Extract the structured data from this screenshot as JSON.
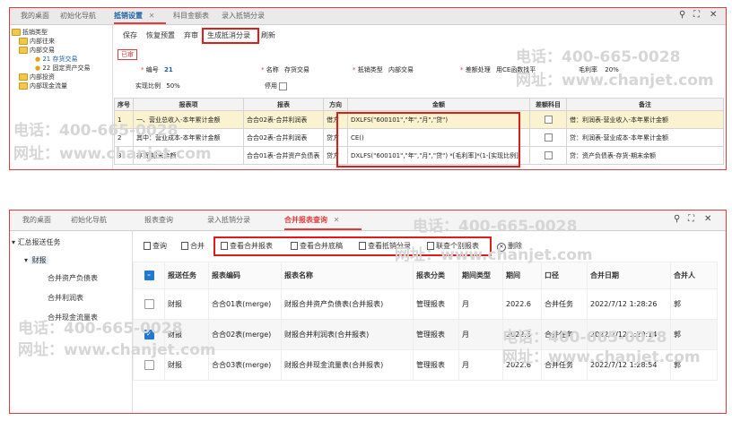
{
  "top": {
    "tabs": [
      {
        "label": "我的桌面"
      },
      {
        "label": "初始化导航"
      },
      {
        "label": "抵销设置"
      },
      {
        "label": "科目金额表"
      },
      {
        "label": "录入抵销分录"
      }
    ],
    "tree": {
      "root": "抵销类型",
      "items": [
        "内部往来",
        "内部交易",
        "21 存货交易",
        "22 固定资产交易",
        "内部投资",
        "内部现金流量"
      ]
    },
    "toolbar": {
      "save": "保存",
      "restore": "恢复预置",
      "reject": "弃审",
      "generate": "生成抵消分录",
      "refresh": "刷新"
    },
    "status_badge": "已审",
    "form": {
      "code_label": "编号",
      "code_value": "21",
      "name_label": "名称",
      "name_value": "存货交易",
      "type_label": "抵销类型",
      "type_value": "内部交易",
      "diff_label": "差额处理",
      "diff_value": "用CE函数找平",
      "margin_label": "毛利率",
      "margin_value": "20%",
      "ratio_label": "实现比例",
      "ratio_value": "50%",
      "disable_label": "停用"
    },
    "table": {
      "headers": [
        "序号",
        "报表项",
        "报表",
        "方向",
        "金额",
        "差额科目",
        "备注"
      ],
      "rows": [
        {
          "no": "1",
          "item": "一、营业总收入-本年累计金额",
          "report": "合合02表-合并利润表",
          "dir": "借方",
          "amount": "DXLFS(\"600101\",\"年\",\"月\",\"贷\")",
          "note": "借：利润表-营业收入-本年累计金额"
        },
        {
          "no": "2",
          "item": "其中：营业成本-本年累计金额",
          "report": "合合02表-合并利润表",
          "dir": "贷方",
          "amount": "CE()",
          "note": "贷：利润表-营业成本-本年累计金额"
        },
        {
          "no": "3",
          "item": "存货-期末余额",
          "report": "合合01表-合并资产负债表",
          "dir": "贷方",
          "amount": "DXLFS(\"600101\",\"年\",\"月\",\"贷\")  *[毛利率]*(1-[实现比例])",
          "note": "贷：资产负债表-存货-期末余额"
        }
      ]
    }
  },
  "bottom": {
    "tabs": [
      {
        "label": "我的桌面"
      },
      {
        "label": "初始化导航"
      },
      {
        "label": "报表查询"
      },
      {
        "label": "录入抵销分录"
      },
      {
        "label": "合并报表查询"
      }
    ],
    "tree": {
      "root": "汇总报送任务",
      "group": "财报",
      "items": [
        "合并资产负债表",
        "合并利润表",
        "合并现金流量表"
      ]
    },
    "toolbar": {
      "query": "查询",
      "merge": "合并",
      "view_merged": "查看合并报表",
      "view_draft": "查看合并底稿",
      "view_elim": "查看抵销分录",
      "link_individual": "联查个别报表",
      "delete": "删除"
    },
    "table": {
      "headers": [
        "报送任务",
        "报表编码",
        "报表名称",
        "报表分类",
        "期间类型",
        "期间",
        "口径",
        "合并日期",
        "合并人"
      ],
      "rows": [
        {
          "task": "财报",
          "code": "合合01表(merge)",
          "name": "财报合并资产负债表(合并报表)",
          "cat": "管理报表",
          "ptype": "月",
          "period": "2022.6",
          "scope": "合并任务",
          "date": "2022/7/12 1:28:26",
          "user": "郭",
          "checked": false
        },
        {
          "task": "财报",
          "code": "合合02表(merge)",
          "name": "财报合并利润表(合并报表)",
          "cat": "管理报表",
          "ptype": "月",
          "period": "2022.6",
          "scope": "合并任务",
          "date": "2022/7/12 1:29:14",
          "user": "郭",
          "checked": true
        },
        {
          "task": "财报",
          "code": "合合03表(merge)",
          "name": "财报合并现金流量表(合并报表)",
          "cat": "管理报表",
          "ptype": "月",
          "period": "2022.6",
          "scope": "合并任务",
          "date": "2022/7/12 1:28:54",
          "user": "郭",
          "checked": false
        }
      ]
    }
  },
  "watermark": {
    "phone": "电话：400-665-0028",
    "site": "网址：www.chanjet.com"
  }
}
